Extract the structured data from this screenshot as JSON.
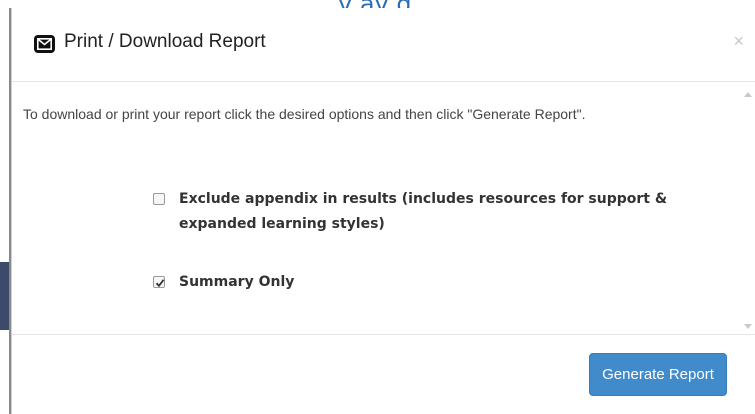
{
  "background": {
    "text": "y  ay       g      ,"
  },
  "dialog": {
    "title": "Print / Download Report",
    "close_label": "×",
    "intro": "To download or print your report click the desired options and then click \"Generate Report\".",
    "options": [
      {
        "label": "Exclude appendix in results (includes resources for support & expanded learning styles)",
        "checked": false
      },
      {
        "label": "Summary Only",
        "checked": true
      }
    ],
    "generate_label": "Generate Report"
  }
}
